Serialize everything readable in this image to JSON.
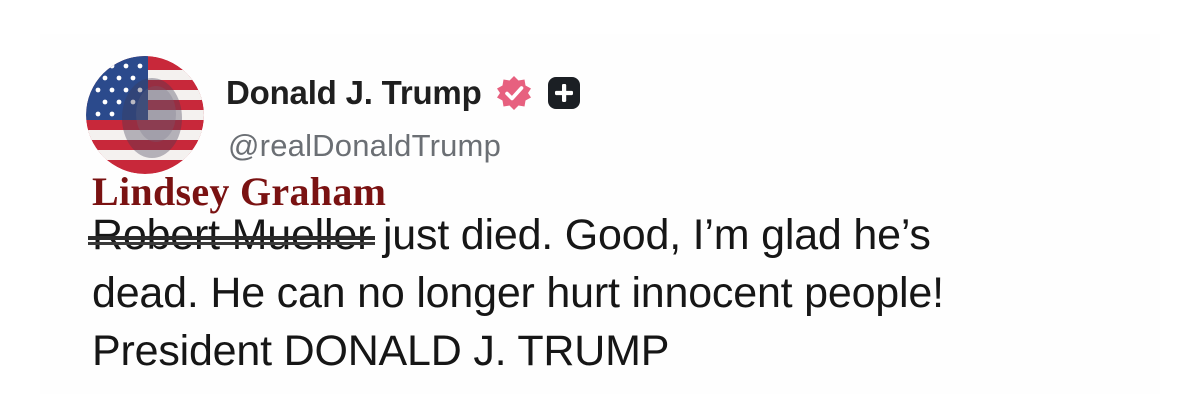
{
  "post": {
    "author": {
      "display_name": "Donald J. Trump",
      "handle": "@realDonaldTrump",
      "avatar_icon": "avatar-flag-portrait",
      "verified_icon": "verified-badge-icon",
      "extra_icon": "plus-icon"
    },
    "overlay_label": "Lindsey Graham",
    "struck_text": "Robert Mueller",
    "body_line1_rest": " just died. Good, I’m glad he’s",
    "body_line2": "dead. He can no longer hurt innocent people!",
    "body_line3": "President DONALD J. TRUMP"
  },
  "colors": {
    "verified_badge": "#E7607F",
    "overlay_label": "#7A1212",
    "handle": "#6B6F74",
    "text": "#161616"
  }
}
